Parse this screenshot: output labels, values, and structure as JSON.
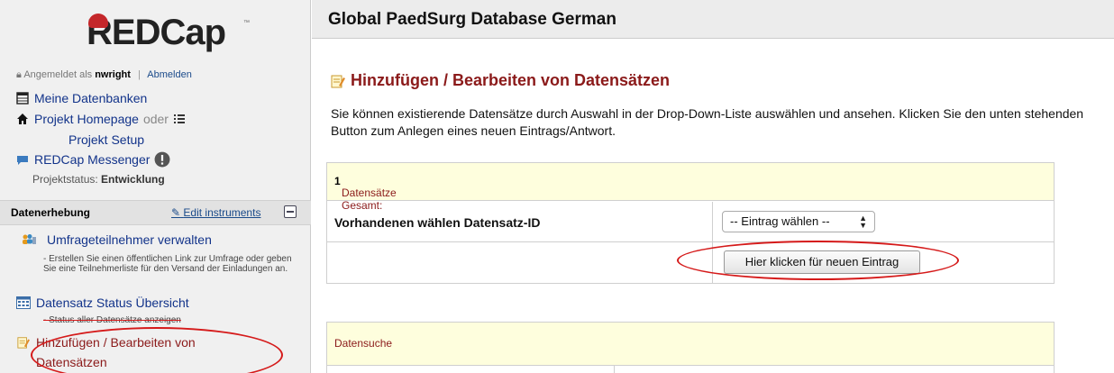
{
  "app": {
    "logo_text": "REDCap",
    "logo_tm": "™"
  },
  "sidebar": {
    "login_prefix": "Angemeldet als",
    "username": "nwright",
    "logout": "Abmelden",
    "nav": {
      "my_projects": "Meine Datenbanken",
      "project_home": "Projekt Homepage",
      "oder": "oder",
      "project_setup": "Projekt Setup",
      "messenger": "REDCap Messenger"
    },
    "project_status_label": "Projektstatus:",
    "project_status_value": "Entwicklung",
    "section_title": "Datenerhebung",
    "edit_instruments": "Edit instruments",
    "instruments": [
      {
        "label": "Umfrageteilnehmer verwalten",
        "description": "- Erstellen Sie einen öffentlichen Link zur Umfrage oder geben Sie eine Teilnehmerliste für den Versand der Einladungen an."
      },
      {
        "label": "Datensatz Status Übersicht",
        "description": "- Status aller Datensätze anzeigen"
      },
      {
        "label_line1": "Hinzufügen / Bearbeiten von",
        "label_line2": "Datensätzen"
      }
    ]
  },
  "header": {
    "project_title": "Global PaedSurg Database German"
  },
  "main": {
    "page_title": "Hinzufügen / Bearbeiten von Datensätzen",
    "intro": "Sie können existierende Datensätze durch Auswahl in der Drop-Down-Liste auswählen und ansehen. Klicken Sie den unten stehenden Button zum Anlegen eines neuen Eintrags/Antwort.",
    "records_total_label": "Datensätze Gesamt:",
    "records_total_value": "1",
    "choose_label": "Vorhandenen wählen Datensatz-ID",
    "select_value": "-- Eintrag wählen --",
    "new_record_button": "Hier klicken für neuen Eintrag",
    "search_header": "Datensuche"
  },
  "colors": {
    "accent_red": "#8b1a1a",
    "link_blue": "#12338a",
    "panel_yellow": "#fefedd",
    "annotation_red": "#d51a1a"
  }
}
